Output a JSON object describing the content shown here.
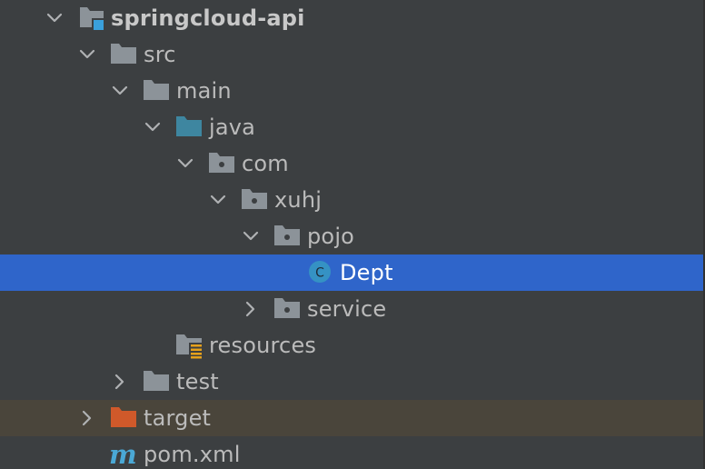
{
  "tree": {
    "items": [
      {
        "label": "springcloud-api",
        "icon": "module-folder-icon",
        "expanded": true
      },
      {
        "label": "src",
        "icon": "folder-icon",
        "expanded": true
      },
      {
        "label": "main",
        "icon": "folder-icon",
        "expanded": true
      },
      {
        "label": "java",
        "icon": "source-root-folder-icon",
        "expanded": true
      },
      {
        "label": "com",
        "icon": "package-icon",
        "expanded": true
      },
      {
        "label": "xuhj",
        "icon": "package-icon",
        "expanded": true
      },
      {
        "label": "pojo",
        "icon": "package-icon",
        "expanded": true
      },
      {
        "label": "Dept",
        "icon": "class-icon",
        "selected": true
      },
      {
        "label": "service",
        "icon": "package-icon",
        "expanded": false
      },
      {
        "label": "resources",
        "icon": "resources-folder-icon"
      },
      {
        "label": "test",
        "icon": "folder-icon",
        "expanded": false
      },
      {
        "label": "target",
        "icon": "excluded-folder-icon",
        "expanded": false
      },
      {
        "label": "pom.xml",
        "icon": "maven-icon",
        "icon_text": "m"
      }
    ]
  },
  "colors": {
    "background": "#3c3f41",
    "selection": "#2f65ca",
    "excluded_row": "#4a453b",
    "folder": "#8c9399",
    "source_folder": "#3e86a0",
    "excluded_folder": "#d0592a",
    "class_icon": "#3592c4",
    "maven": "#4aa8d5",
    "text": "#bbbbbb"
  }
}
